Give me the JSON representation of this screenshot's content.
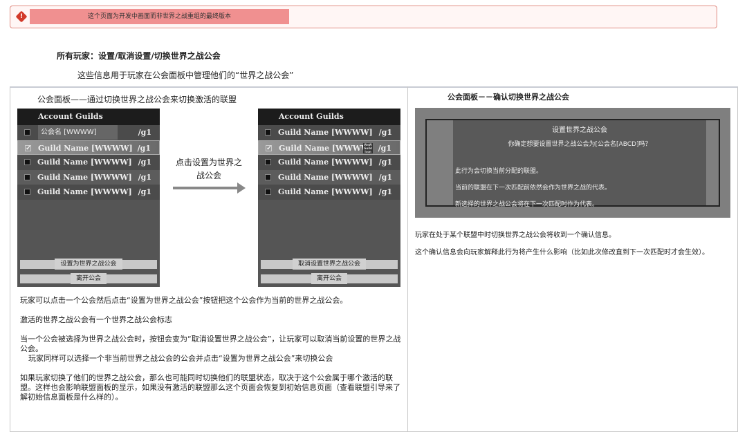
{
  "alert": {
    "icon": "error-diamond-icon",
    "message": "这个页面为开发中画面而非世界之战重组的最终版本",
    "color": "#f09090"
  },
  "heading": "所有玩家：设置/取消设置/切换世界之战公会",
  "subtitle": "这些信息用于玩家在公会面板中管理他们的“世界之战公会”",
  "left": {
    "caption": "公会面板——通过切换世界之战公会来切换激活的联盟",
    "panel_before": {
      "title": "Account Guilds",
      "rows": [
        {
          "name": "公会名 [WWWW]",
          "tag": "/g1",
          "checked": false
        },
        {
          "name": "Guild Name [WWWW]",
          "tag": "/g1",
          "checked": true
        },
        {
          "name": "Guild Name [WWWW]",
          "tag": "/g1",
          "checked": false
        },
        {
          "name": "Guild Name [WWWW]",
          "tag": "/g1",
          "checked": false
        },
        {
          "name": "Guild Name [WWWW]",
          "tag": "/g1",
          "checked": false
        }
      ],
      "primary_button": "设置为世界之战公会",
      "leave_button": "离开公会"
    },
    "arrow_label": "点击设置为世界之战公会",
    "panel_after": {
      "title": "Account Guilds",
      "rows": [
        {
          "name": "Guild Name [WWWW]",
          "tag": "/g1",
          "checked": false
        },
        {
          "name": "Guild Name [WWWW]",
          "tag": "/g1",
          "checked": true,
          "badge": "WvW Guild Icon"
        },
        {
          "name": "Guild Name [WWWW]",
          "tag": "/g1",
          "checked": false
        },
        {
          "name": "Guild Name [WWWW]",
          "tag": "/g1",
          "checked": false
        },
        {
          "name": "Guild Name [WWWW]",
          "tag": "/g1",
          "checked": false
        }
      ],
      "primary_button": "取消设置世界之战公会",
      "leave_button": "离开公会"
    },
    "paragraphs": [
      "玩家可以点击一个公会然后点击“设置为世界之战公会”按钮把这个公会作为当前的世界之战公会。",
      "激活的世界之战公会有一个世界之战公会标志",
      "当一个公会被选择为世界之战公会时，按钮会变为“取消设置世界之战公会”，让玩家可以取消当前设置的世界之战公会。",
      "玩家同样可以选择一个非当前世界之战公会的公会并点击“设置为世界之战公会”来切换公会",
      "如果玩家切换了他们的世界之战公会，那么也可能同时切换他们的联盟状态，取决于这个公会属于哪个激活的联盟。这样也会影响联盟面板的显示，如果没有激活的联盟那么这个页面会恢复到初始信息页面（查看联盟引导来了解初始信息面板是什么样的）。"
    ]
  },
  "right": {
    "caption": "公会面板－－确认切换世界之战公会",
    "dialog": {
      "title": "设置世界之战公会",
      "question": "你确定想要设置世界之战公会为[公会名[ABCD]吗？",
      "lines": [
        "此行为会切换当前分配的联盟。",
        "当前的联盟在下一次匹配前依然会作为世界之战的代表。",
        "新选择的世界之战公会将在下一次匹配时作为代表。"
      ]
    },
    "paragraphs": [
      "玩家在处于某个联盟中时切换世界之战公会将收到一个确认信息。",
      "这个确认信息会向玩家解释此行为将产生什么影响（比如此次修改直到下一次匹配时才会生效）。"
    ]
  }
}
